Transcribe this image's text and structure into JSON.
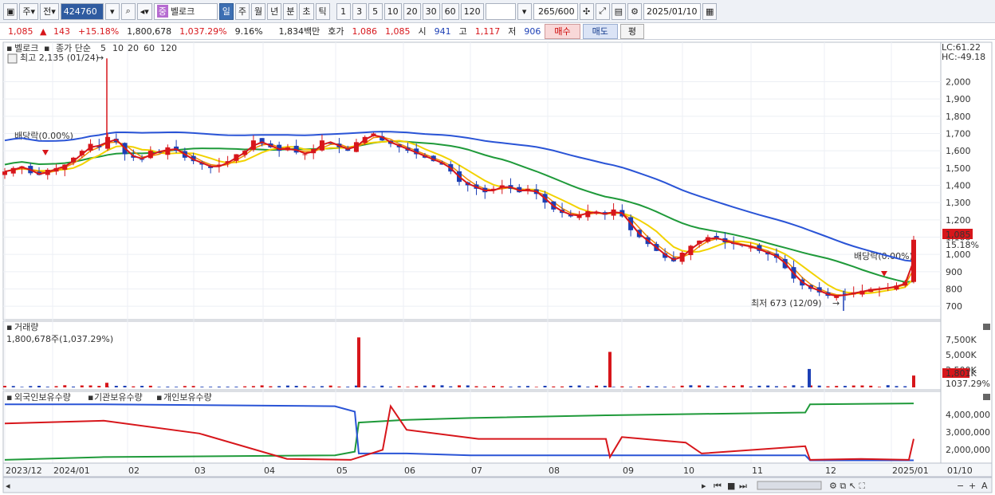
{
  "toolbar": {
    "items": [
      "주",
      "전"
    ],
    "code": "424760",
    "stock_name": "벨로크",
    "periods": [
      "일",
      "주",
      "월",
      "년",
      "분",
      "초",
      "틱"
    ],
    "active_period": "일",
    "intervals": [
      "1",
      "3",
      "5",
      "10",
      "20",
      "30",
      "60",
      "120"
    ],
    "count": "265",
    "count_total": "/600",
    "date": "2025/01/10"
  },
  "info": {
    "price": "1,085",
    "change": "143",
    "change_pct": "+15.18%",
    "volume": "1,800,678",
    "volume_pct": "1,037.29%",
    "turnover": "9.16%",
    "amount": "1,834백만",
    "quote_label": "호가",
    "ask": "1,086",
    "bid": "1,085",
    "open_label": "시",
    "open": "941",
    "high_label": "고",
    "high": "1,117",
    "low_label": "저",
    "low": "906",
    "buy_label": "매수",
    "sell_label": "매도",
    "eval_label": "평"
  },
  "price_panel": {
    "legend_name": "벨로크",
    "legend_type": "종가 단순",
    "ma_labels": [
      {
        "label": "5",
        "color": "#d7161b"
      },
      {
        "label": "10",
        "color": "#f08a00"
      },
      {
        "label": "20",
        "color": "#f2d200"
      },
      {
        "label": "60",
        "color": "#1f9a3a"
      },
      {
        "label": "120",
        "color": "#2a54d6"
      }
    ],
    "high_marker": "최고 2,135 (01/24)",
    "low_marker": "최저 673 (12/09)",
    "dividend_1": "배당락(0.00%)",
    "dividend_2": "배당락(0.00%)",
    "lc": "LC:61.22",
    "hc": "HC:-49.18",
    "current_price_tag": "1,085",
    "current_pct_tag": "15.18%",
    "y_ticks": [
      "2,000",
      "1,900",
      "1,800",
      "1,700",
      "1,600",
      "1,500",
      "1,400",
      "1,300",
      "1,200",
      "1,100",
      "1,000",
      "900",
      "800",
      "700"
    ]
  },
  "volume_panel": {
    "title": "거래량",
    "value": "1,800,678주(1,037.29%)",
    "y_ticks": [
      "7,500K",
      "5,000K",
      "2,500K"
    ],
    "tag": "1,801K",
    "tag_pct": "1037.29%"
  },
  "holdings_panel": {
    "legend": [
      {
        "label": "외국인보유수량",
        "color": "#d7161b"
      },
      {
        "label": "기관보유수량",
        "color": "#2a54d6"
      },
      {
        "label": "개인보유수량",
        "color": "#1f9a3a"
      }
    ],
    "y_ticks": [
      "4,000,000",
      "3,000,000",
      "2,000,000"
    ]
  },
  "x_axis": [
    "2023/12",
    "2024/01",
    "02",
    "03",
    "04",
    "05",
    "06",
    "07",
    "08",
    "09",
    "10",
    "11",
    "12",
    "2025/01",
    "01/10"
  ],
  "chart_data": {
    "type": "candlestick",
    "price_range": [
      650,
      2150
    ],
    "closes": [
      1480,
      1500,
      1510,
      1470,
      1460,
      1490,
      1500,
      1520,
      1560,
      1600,
      1640,
      1620,
      1680,
      1650,
      1580,
      1560,
      1550,
      1600,
      1590,
      1620,
      1600,
      1560,
      1540,
      1520,
      1500,
      1520,
      1540,
      1580,
      1600,
      1660,
      1640,
      1620,
      1600,
      1620,
      1590,
      1580,
      1610,
      1660,
      1640,
      1620,
      1600,
      1650,
      1680,
      1700,
      1660,
      1640,
      1620,
      1600,
      1580,
      1560,
      1540,
      1520,
      1480,
      1420,
      1400,
      1380,
      1360,
      1380,
      1400,
      1380,
      1360,
      1380,
      1350,
      1300,
      1260,
      1240,
      1220,
      1230,
      1250,
      1240,
      1230,
      1260,
      1220,
      1140,
      1100,
      1060,
      1020,
      980,
      960,
      1010,
      1050,
      1080,
      1100,
      1090,
      1070,
      1060,
      1050,
      1040,
      1020,
      1000,
      980,
      920,
      860,
      820,
      800,
      780,
      760,
      760,
      770,
      780,
      790,
      800,
      800,
      810,
      820,
      840,
      1085
    ],
    "volume_spikes_k": [
      {
        "date": "2024-01-24",
        "volume": 700
      },
      {
        "date": "2024-05-09",
        "volume": 7600
      },
      {
        "date": "2024-08-28",
        "volume": 5400
      },
      {
        "date": "2024-12-09",
        "volume": 2800
      },
      {
        "date": "2025-01-10",
        "volume": 1801
      }
    ]
  }
}
